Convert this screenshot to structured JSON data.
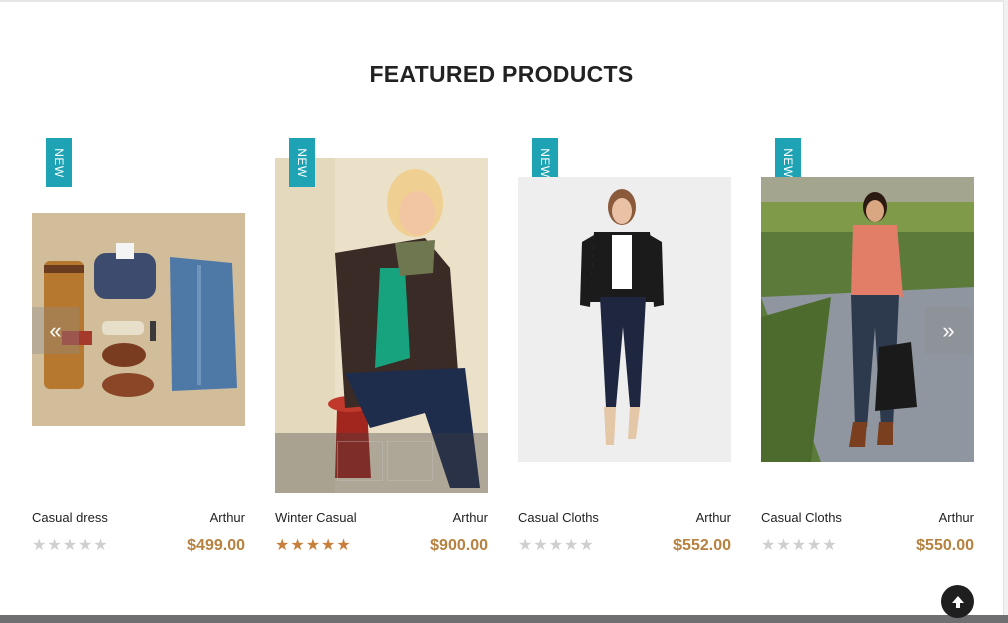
{
  "section": {
    "title": "FEATURED PRODUCTS"
  },
  "products": [
    {
      "badge": "NEW",
      "name": "Casual dress",
      "author": "Arthur",
      "price": "$499.00",
      "rating": 0,
      "image": "flat-lay-menswear"
    },
    {
      "badge": "NEW",
      "name": "Winter Casual",
      "author": "Arthur",
      "price": "$900.00",
      "rating": 5,
      "image": "woman-blazer-scarf-stool"
    },
    {
      "badge": "NEW",
      "name": "Casual Cloths",
      "author": "Arthur",
      "price": "$552.00",
      "rating": 0,
      "image": "woman-black-jacket-white-bg"
    },
    {
      "badge": "NEW",
      "name": "Casual Cloths",
      "author": "Arthur",
      "price": "$550.00",
      "rating": 0,
      "image": "woman-pink-shirt-park"
    }
  ],
  "carousel": {
    "prev_icon": "«",
    "next_icon": "»"
  },
  "back_to_top": {
    "icon": "arrow-up-icon"
  },
  "colors": {
    "badge": "#1da3b3",
    "price": "#b7813f",
    "star_on": "#c97f3c",
    "star_off": "#cfcfcf"
  }
}
